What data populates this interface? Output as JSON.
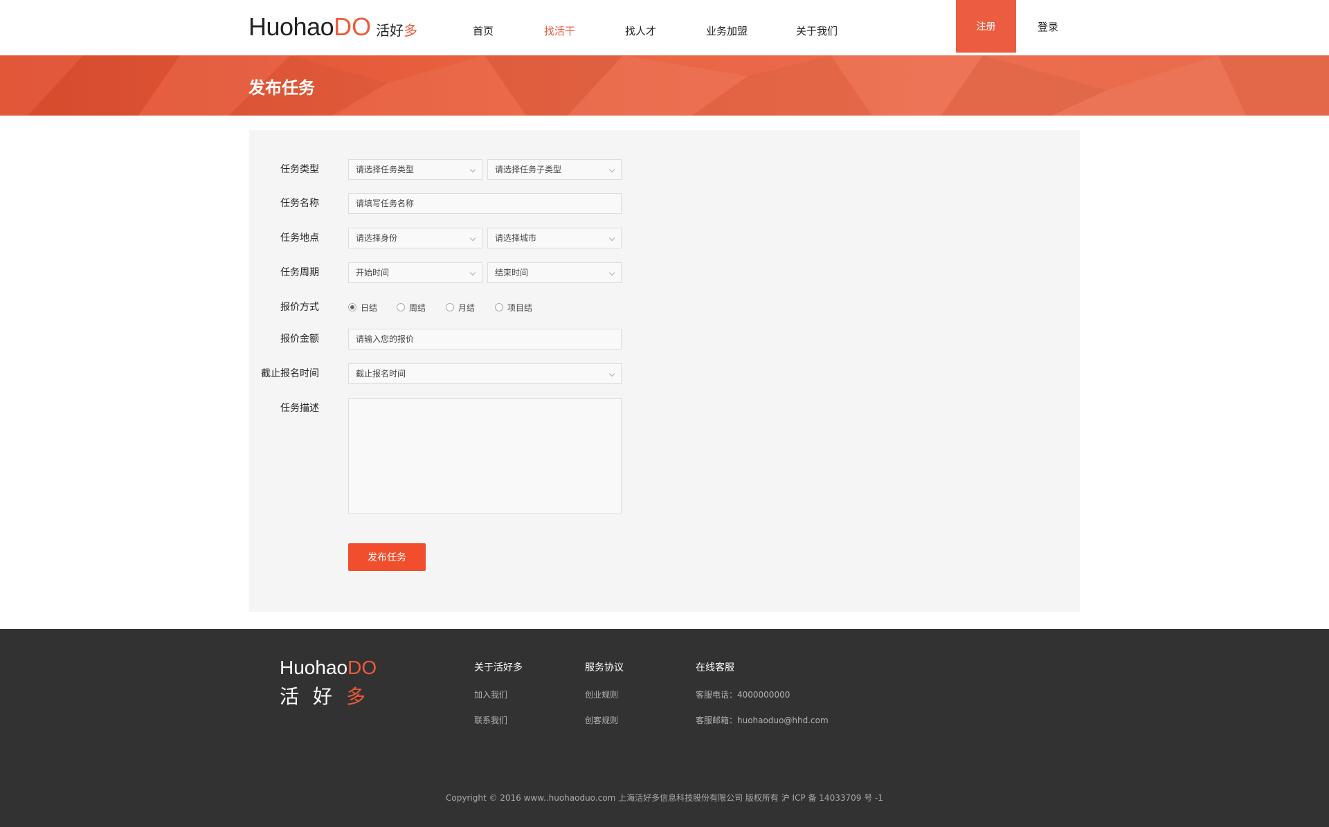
{
  "header": {
    "logo_huohao": "Huohao",
    "logo_do": "DO",
    "logo_cn": "活好",
    "logo_cn_accent": "多",
    "nav": [
      {
        "label": "首页",
        "active": false
      },
      {
        "label": "找活干",
        "active": true
      },
      {
        "label": "找人才",
        "active": false
      },
      {
        "label": "业务加盟",
        "active": false
      },
      {
        "label": "关于我们",
        "active": false
      }
    ],
    "register_label": "注册",
    "login_label": "登录"
  },
  "banner": {
    "title": "发布任务"
  },
  "form": {
    "task_type": {
      "label": "任务类型",
      "select1": "请选择任务类型",
      "select2": "请选择任务子类型"
    },
    "task_name": {
      "label": "任务名称",
      "placeholder": "请填写任务名称"
    },
    "task_location": {
      "label": "任务地点",
      "select1": "请选择身份",
      "select2": "请选择城市"
    },
    "task_period": {
      "label": "任务周期",
      "select1": "开始时间",
      "select2": "结束时间"
    },
    "pricing_method": {
      "label": "报价方式",
      "options": [
        "日结",
        "周结",
        "月结",
        "项目结"
      ],
      "selected": "日结"
    },
    "price_amount": {
      "label": "报价金额",
      "placeholder": "请输入您的报价"
    },
    "deadline": {
      "label": "截止报名时间",
      "select": "截止报名时间"
    },
    "description": {
      "label": "任务描述",
      "value": ""
    },
    "submit_label": "发布任务"
  },
  "footer": {
    "logo_huohao": "Huohao",
    "logo_do": "DO",
    "logo_cn": "活好",
    "logo_cn_accent": "多",
    "columns": [
      {
        "head": "关于活好多",
        "links": [
          "加入我们",
          "联系我们"
        ]
      },
      {
        "head": "服务协议",
        "links": [
          "创业规则",
          "创客规则"
        ]
      },
      {
        "head": "在线客服",
        "links": [
          "客服电话：4000000000",
          "客服邮箱：huohaoduo@hhd.com"
        ]
      }
    ],
    "copyright": "Copyright © 2016 www..huohaoduo.com 上海活好多信息科技股份有限公司 版权所有 沪 ICP 备 14033709 号 -1"
  },
  "colors": {
    "brand": "#ee5a3b",
    "button": "#f04e2c",
    "footer_bg": "#323232",
    "panel_bg": "#f5f5f5"
  },
  "icons": [
    "chevron-down-icon",
    "radio-icon"
  ]
}
